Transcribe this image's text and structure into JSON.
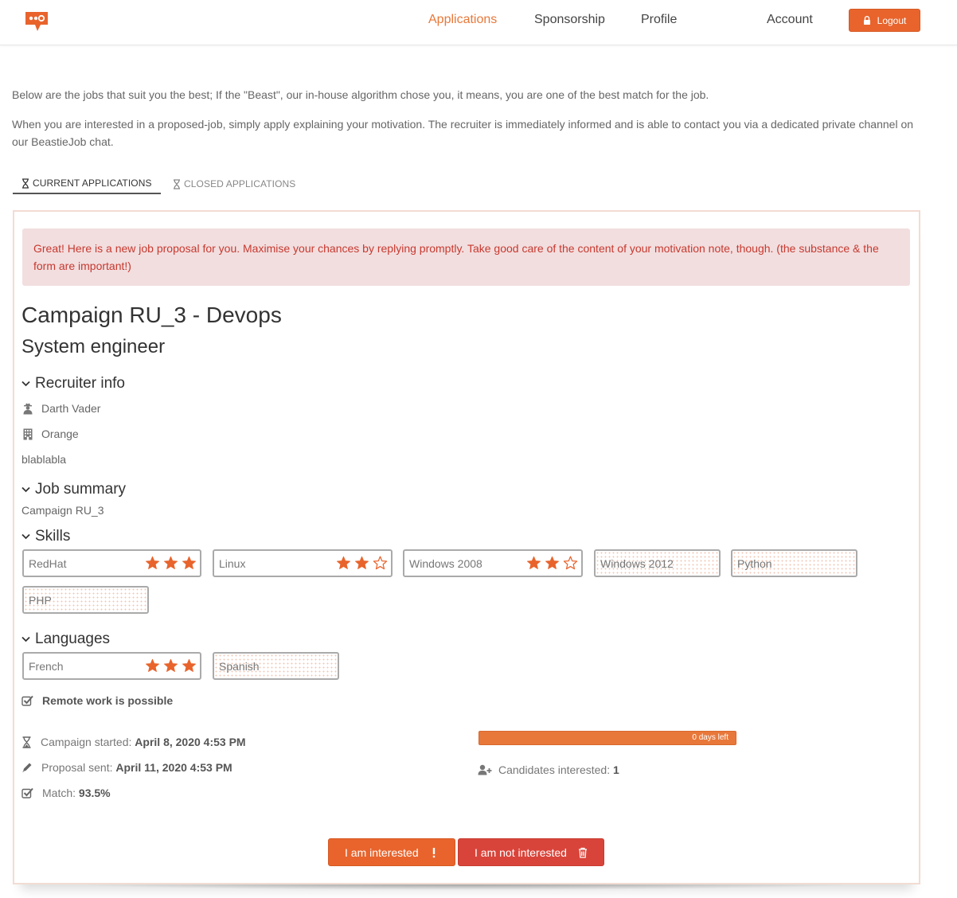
{
  "nav": {
    "links": [
      {
        "label": "Applications",
        "active": true
      },
      {
        "label": "Sponsorship"
      },
      {
        "label": "Profile"
      },
      {
        "label": "Account"
      }
    ],
    "logout_label": "Logout"
  },
  "intro": {
    "line1": "Below are the jobs that suit you the best; If the \"Beast\", our in-house algorithm chose you, it means, you are one of the best match for the job.",
    "line2": "When you are interested in a proposed-job, simply apply explaining your motivation. The recruiter is immediately informed and is able to contact you via a dedicated private channel on our BeastieJob chat."
  },
  "tabs": [
    {
      "label": "CURRENT APPLICATIONS",
      "active": true
    },
    {
      "label": "CLOSED APPLICATIONS",
      "active": false
    }
  ],
  "proposal": {
    "alert": "Great! Here is a new job proposal for you. Maximise your chances by replying promptly. Take good care of the content of your motivation note, though. (the substance & the form are important!)",
    "title": "Campaign RU_3 - Devops",
    "subtitle": "System engineer",
    "recruiter": {
      "heading": "Recruiter info",
      "name": "Darth Vader",
      "company": "Orange",
      "description": "blablabla"
    },
    "summary": {
      "heading": "Job summary",
      "text": "Campaign RU_3"
    },
    "skills": {
      "heading": "Skills",
      "items": [
        {
          "name": "RedHat",
          "rating": 3,
          "max": 3
        },
        {
          "name": "Linux",
          "rating": 2,
          "max": 3
        },
        {
          "name": "Windows 2008",
          "rating": 2,
          "max": 3
        },
        {
          "name": "Windows 2012",
          "rating": 0,
          "max": 0
        },
        {
          "name": "Python",
          "rating": 0,
          "max": 0
        },
        {
          "name": "PHP",
          "rating": 0,
          "max": 0
        }
      ]
    },
    "languages": {
      "heading": "Languages",
      "items": [
        {
          "name": "French",
          "rating": 3,
          "max": 3
        },
        {
          "name": "Spanish",
          "rating": 0,
          "max": 0
        }
      ]
    },
    "remote": "Remote work is possible",
    "campaign_started_label": "Campaign started:",
    "campaign_started_value": "April 8, 2020 4:53 PM",
    "proposal_sent_label": "Proposal sent:",
    "proposal_sent_value": "April 11, 2020 4:53 PM",
    "match_label": "Match:",
    "match_value": "93.5%",
    "progress_label": "0 days left",
    "progress_fraction": 1.0,
    "candidates_label": "Candidates interested:",
    "candidates_value": "1",
    "interested_label": "I am interested",
    "not_interested_label": "I am not interested"
  },
  "colors": {
    "accent": "#e8783a",
    "button_primary": "#e8642c",
    "button_danger": "#d9443a",
    "alert_bg": "#f2dedf",
    "alert_text": "#c7392f"
  }
}
